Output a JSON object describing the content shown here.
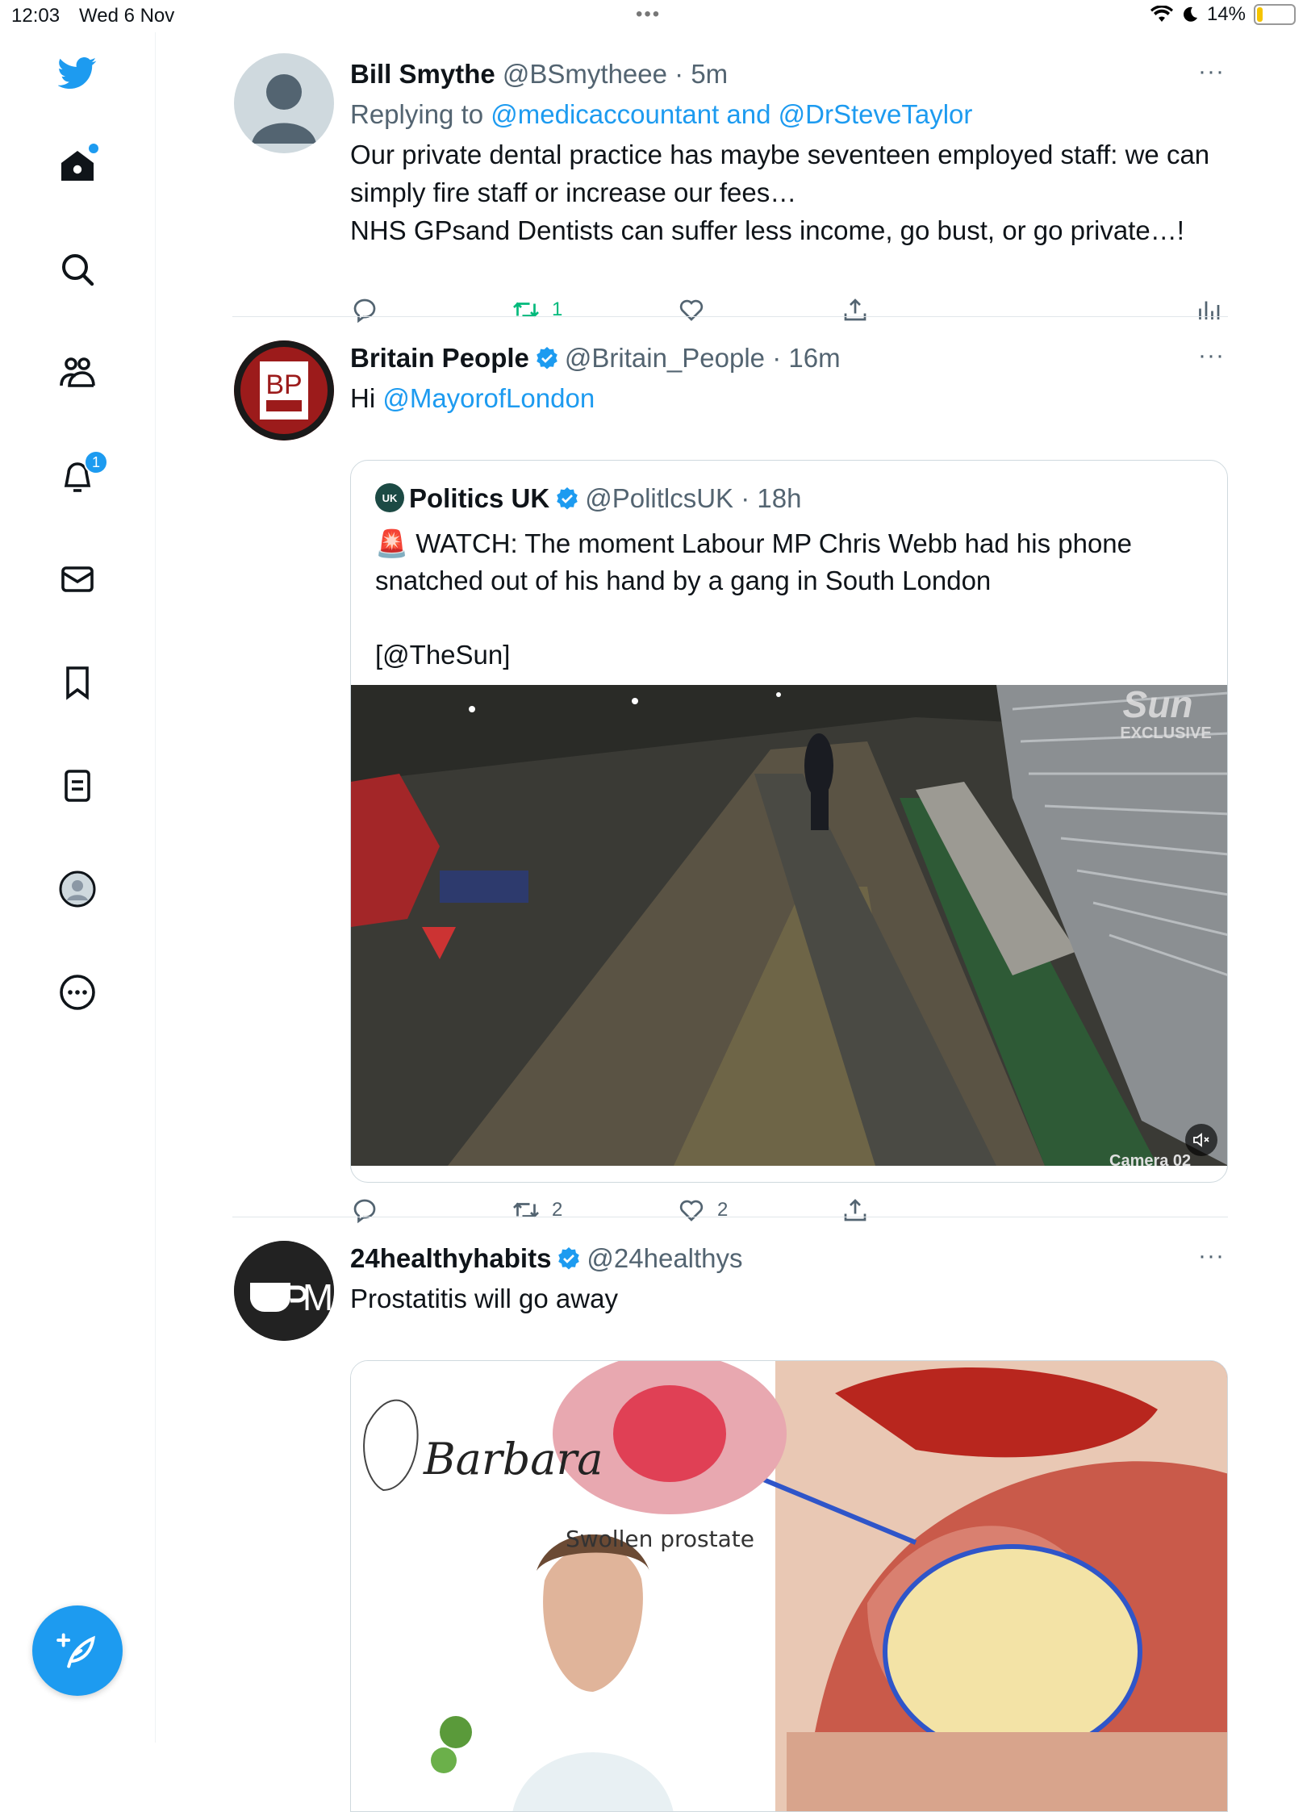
{
  "status_bar": {
    "time": "12:03",
    "date": "Wed 6 Nov",
    "battery": "14%",
    "battery_level": 0.14
  },
  "sidebar": {
    "notifications_badge": "1"
  },
  "tweets": [
    {
      "name": "Bill Smythe",
      "handle": "@BSmytheee",
      "time": "· 5m",
      "replying_label": "Replying to",
      "replying_to": "@medicaccountant and @DrSteveTaylor",
      "text_line1": "Our private dental practice has maybe seventeen employed staff: we can simply fire staff or increase our fees…",
      "text_line2": "NHS GPsand Dentists can suffer less income, go bust, or go private…!",
      "retweets": "1"
    },
    {
      "name": "Britain People",
      "handle": "@Britain_People",
      "time": "· 16m",
      "text_prefix": "Hi",
      "mention": "@MayorofLondon",
      "avatar_text": "BP",
      "quote": {
        "name": "Politics UK",
        "handle": "@PolitlcsUK",
        "time": "· 18h",
        "avatar_text": "UK",
        "text": "🚨 WATCH: The moment Labour MP Chris Webb had his phone snatched out of his hand by a gang in South London",
        "source": "[@TheSun]",
        "video_overlay_1": "Sun",
        "video_overlay_2": "EXCLUSIVE",
        "video_caption": "Camera 02"
      },
      "retweets": "2",
      "likes": "2"
    },
    {
      "name": "24healthyhabits",
      "handle": "@24healthys",
      "text": "Prostatitis will go away",
      "avatar_text": "M",
      "image_signature": "Barbara",
      "image_label": "Swollen prostate"
    }
  ],
  "colors": {
    "accent": "#1d9bf0",
    "retweet_green": "#00ba7c",
    "text_secondary": "#536471"
  }
}
